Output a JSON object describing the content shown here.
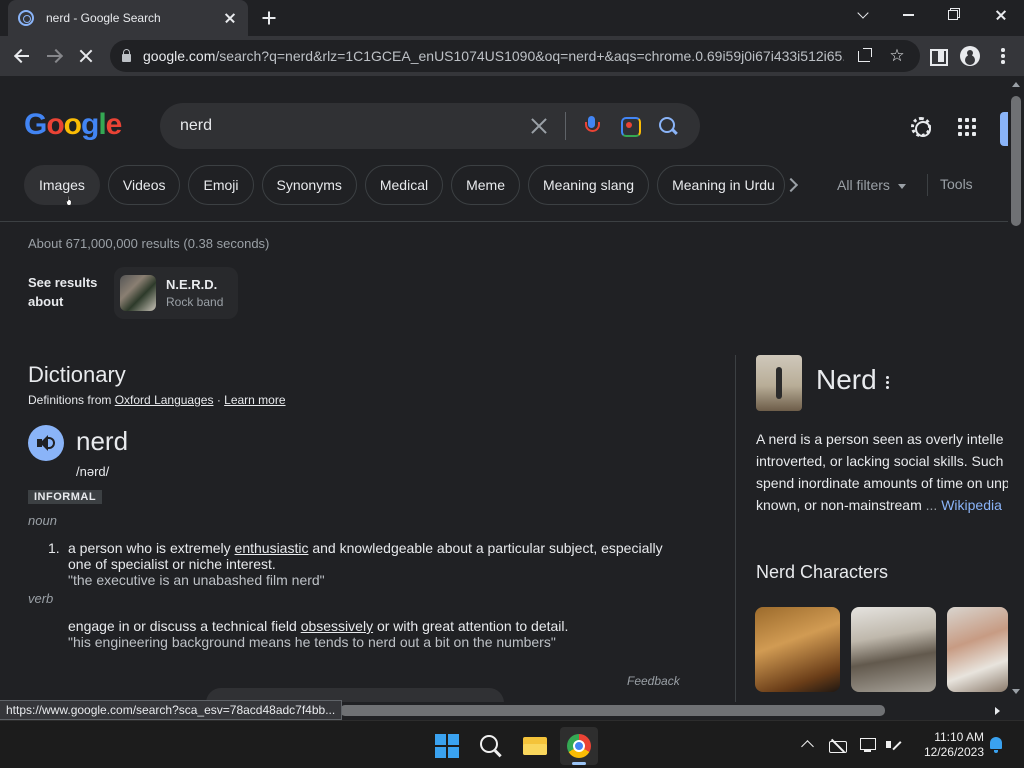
{
  "browser": {
    "tab_title": "nerd - Google Search",
    "url_host": "google.com",
    "url_rest": "/search?q=nerd&rlz=1C1GCEA_enUS1074US1090&oq=nerd+&aqs=chrome.0.69i59j0i67i433i512i65...",
    "status_url": "https://www.google.com/search?sca_esv=78acd48adc7f4bb..."
  },
  "google": {
    "logo_letters": [
      "G",
      "o",
      "o",
      "g",
      "l",
      "e"
    ],
    "query": "nerd",
    "chips": [
      "Images",
      "Videos",
      "Emoji",
      "Synonyms",
      "Medical",
      "Meme",
      "Meaning slang",
      "Meaning in Urdu"
    ],
    "all_filters": "All filters",
    "tools": "Tools",
    "stats": "About 671,000,000 results (0.38 seconds)",
    "see_results_about": "See results about",
    "entity": {
      "name": "N.E.R.D.",
      "type": "Rock band"
    }
  },
  "dictionary": {
    "heading": "Dictionary",
    "definitions_from": "Definitions from",
    "source": "Oxford Languages",
    "separator": "·",
    "learn_more": "Learn more",
    "word": "nerd",
    "phonetic": "/nərd/",
    "register": "INFORMAL",
    "noun": {
      "label": "noun",
      "number": "1.",
      "def_before": "a person who is extremely ",
      "def_link": "enthusiastic",
      "def_after": " and knowledgeable about a particular subject, especially one of specialist or niche interest.",
      "example": "\"the executive is an unabashed film nerd\""
    },
    "verb": {
      "label": "verb",
      "def_before": "engage in or discuss a technical field ",
      "def_link": "obsessively",
      "def_after": " or with great attention to detail.",
      "example": "\"his engineering background means he tends to nerd out a bit on the numbers\""
    },
    "feedback": "Feedback"
  },
  "knowledge_panel": {
    "title": "Nerd",
    "desc_lines": [
      "A nerd is a person seen as overly intelle",
      "introverted, or lacking social skills. Such",
      "spend inordinate amounts of time on unp",
      "known, or non-mainstream "
    ],
    "ellipsis": "...",
    "source": "Wikipedia",
    "characters_heading": "Nerd Characters"
  },
  "taskbar": {
    "time": "11:10 AM",
    "date": "12/26/2023"
  },
  "colors": {
    "page_bg": "#202124",
    "link": "#8ab4f8",
    "text": "#e8eaed",
    "muted": "#9aa0a6"
  }
}
